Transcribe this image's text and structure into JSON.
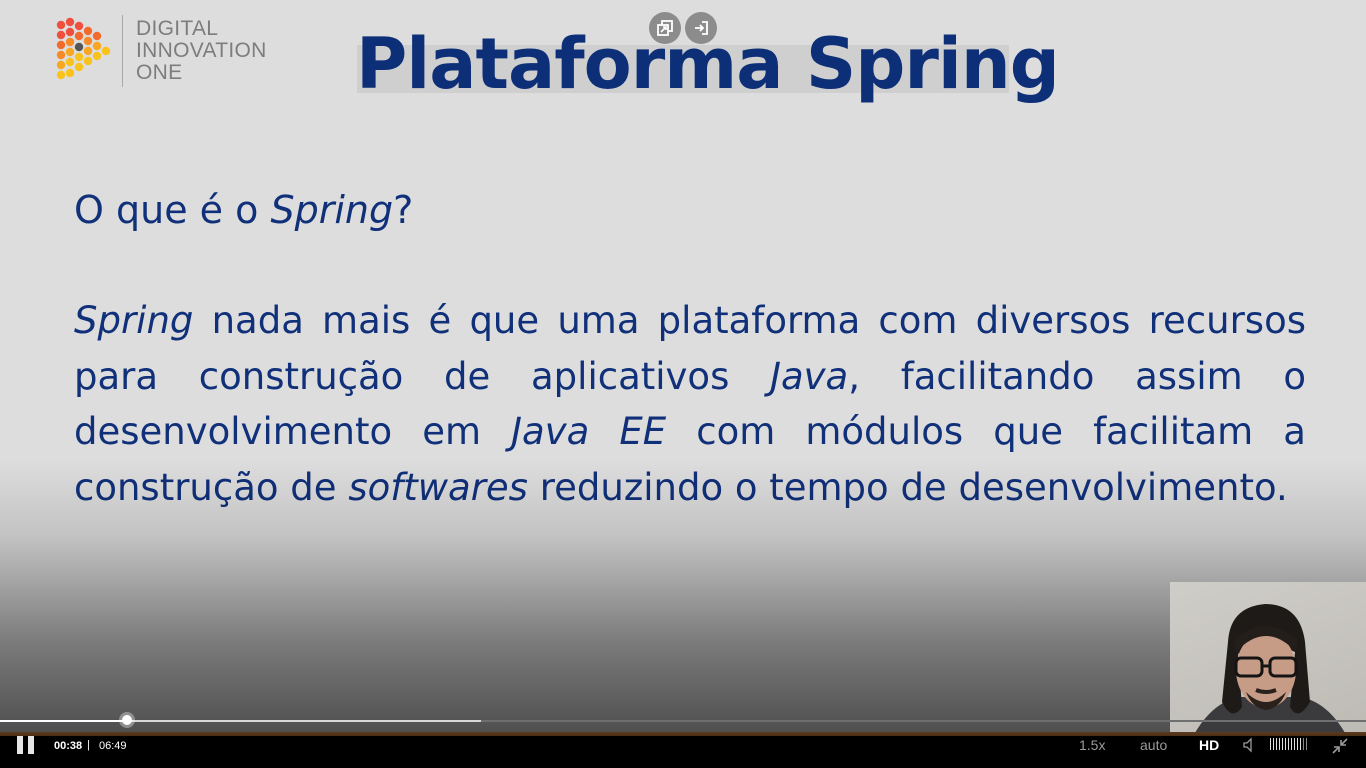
{
  "logo": {
    "lines": [
      "DIGITAL",
      "INNOVATION",
      "ONE"
    ]
  },
  "slide": {
    "title": "Plataforma Spring",
    "question": {
      "prefix": "O que é o ",
      "italic": "Spring",
      "suffix": "?"
    },
    "paragraph": {
      "p1_italic": "Spring",
      "p2": " nada mais é que uma plataforma com diversos recursos para construção de aplicativos ",
      "p3_italic": "Java",
      "p4": ", facilitando assim o desenvolvimento em ",
      "p5_italic": "Java EE",
      "p6": " com módulos que facilitam a construção de ",
      "p7_italic": "softwares",
      "p8": " reduzindo o tempo de desenvolvimento."
    }
  },
  "player": {
    "top_icons": [
      "popout-icon",
      "exit-icon"
    ],
    "current_time": "00:38",
    "separator": "|",
    "duration": "06:49",
    "progress_fraction": 0.093,
    "buffered_fraction": 0.352,
    "speed": "1.5x",
    "quality_mode": "auto",
    "quality_badge": "HD",
    "volume_level": 0.85,
    "colors": {
      "slide_text": "#10307a",
      "title": "#0d2f78",
      "logo_text": "#7d7d7d"
    }
  }
}
